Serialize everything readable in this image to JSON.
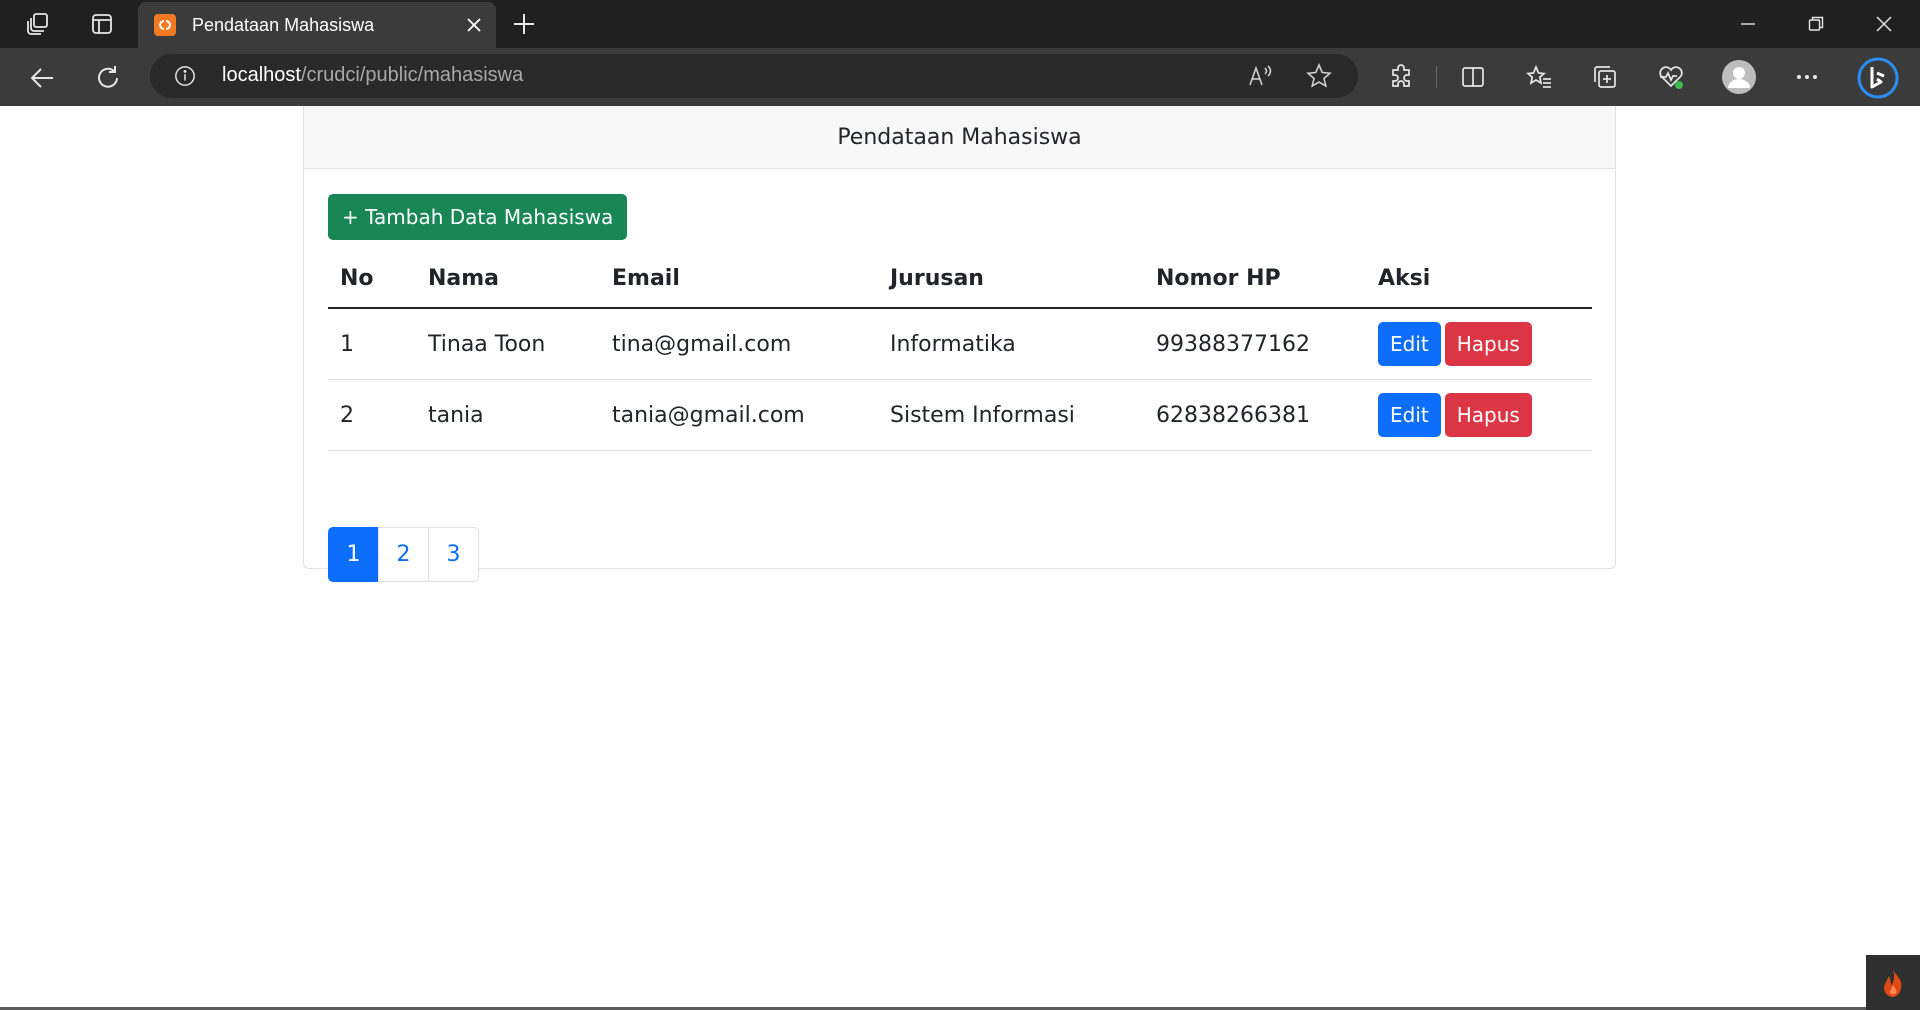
{
  "browser": {
    "tab_title": "Pendataan Mahasiswa",
    "url_host": "localhost",
    "url_path": "/crudci/public/mahasiswa",
    "icons": [
      "workspaces-icon",
      "tab-actions-icon",
      "close-icon",
      "new-tab-icon",
      "minimize-icon",
      "restore-icon",
      "window-close-icon",
      "back-icon",
      "refresh-icon",
      "info-icon",
      "read-aloud-icon",
      "favorite-star-icon",
      "extensions-icon",
      "split-screen-icon",
      "favorites-icon",
      "collections-icon",
      "browser-essentials-icon",
      "profile-icon",
      "more-icon",
      "bing-copilot-icon"
    ]
  },
  "page": {
    "card_title": "Pendataan Mahasiswa",
    "add_button": "+ Tambah Data Mahasiswa",
    "table": {
      "headers": [
        "No",
        "Nama",
        "Email",
        "Jurusan",
        "Nomor HP",
        "Aksi"
      ],
      "rows": [
        {
          "no": "1",
          "nama": "Tinaa Toon",
          "email": "tina@gmail.com",
          "jurusan": "Informatika",
          "hp": "99388377162",
          "edit": "Edit",
          "hapus": "Hapus"
        },
        {
          "no": "2",
          "nama": "tania",
          "email": "tania@gmail.com",
          "jurusan": "Sistem Informasi",
          "hp": "62838266381",
          "edit": "Edit",
          "hapus": "Hapus"
        }
      ]
    },
    "pagination": [
      "1",
      "2",
      "3"
    ],
    "pagination_active": "1"
  },
  "colors": {
    "success": "#198754",
    "primary": "#0d6efd",
    "danger": "#dc3545",
    "chrome_dark": "#202020",
    "chrome_toolbar": "#3b3b3b",
    "codeigniter": "#dd4814"
  }
}
